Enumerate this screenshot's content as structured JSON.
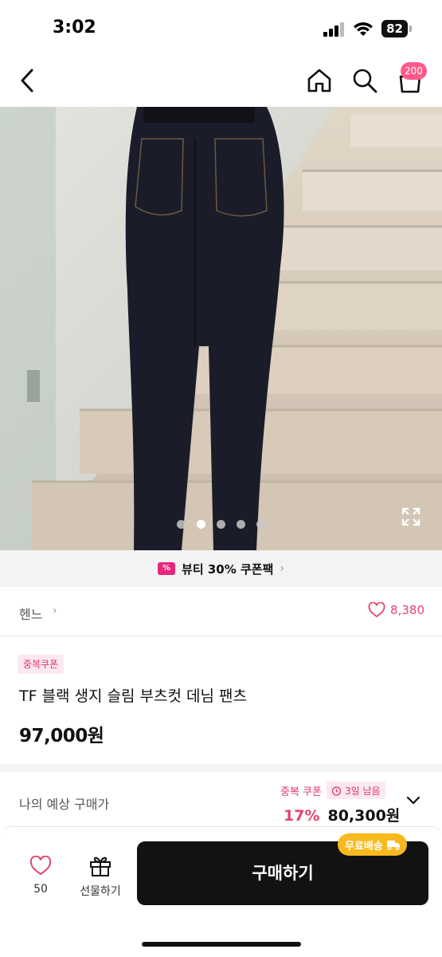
{
  "status_bar": {
    "time": "3:02",
    "battery": "82",
    "icons": [
      "signal-icon",
      "wifi-icon",
      "battery-icon"
    ]
  },
  "top_nav": {
    "icons": [
      "back-icon",
      "home-icon",
      "search-icon",
      "cart-icon"
    ],
    "cart_badge": "200",
    "accent_color": "#ff5a8a"
  },
  "gallery": {
    "dots_total": 5,
    "active_dot_index": 1,
    "icons": [
      "expand-icon"
    ]
  },
  "coupon_banner": {
    "text": "뷰티 30% 쿠폰팩",
    "arrow": "›",
    "icon": "coupon-icon"
  },
  "brand": {
    "name": "헨느",
    "chevron": "›",
    "like_count": "8,380"
  },
  "product": {
    "badge": "중복쿠폰",
    "title": "TF 블랙 생지 슬림 부츠컷 데님 팬츠",
    "price": "97,000원"
  },
  "expected_price": {
    "label": "나의 예상 구매가",
    "coupon_label": "중복 쿠폰",
    "days_left": "3일 남음",
    "discount_rate": "17%",
    "discounted_price": "80,300원"
  },
  "bottom_bar": {
    "wish_count": "50",
    "gift_label": "선물하기",
    "buy_label": "구매하기",
    "free_shipping_label": "무료배송"
  },
  "colors": {
    "pink": "#e6446f",
    "dark_button": "#121212",
    "shipping_badge": "#f7b91d"
  }
}
